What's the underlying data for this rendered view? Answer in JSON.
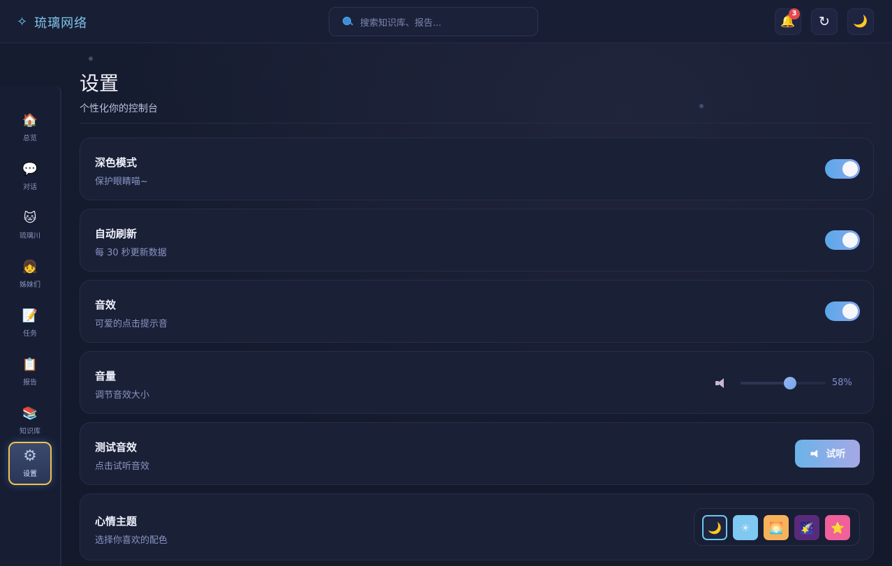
{
  "app": {
    "brand_icon": "sparkle-icon",
    "brand_name": "琉璃网络"
  },
  "search": {
    "placeholder": "搜索知识库、报告..."
  },
  "topbar": {
    "notification_count": "3",
    "bell_icon": "🔔",
    "refresh_icon": "↻",
    "theme_toggle_icon": "🌙"
  },
  "sidebar": {
    "items": [
      {
        "icon": "🏠",
        "label": "总览"
      },
      {
        "icon": "💬",
        "label": "对话"
      },
      {
        "icon": "🐱",
        "label": "琉璃川"
      },
      {
        "icon": "👧",
        "label": "姊妹们"
      },
      {
        "icon": "📝",
        "label": "任务"
      },
      {
        "icon": "📋",
        "label": "报告"
      },
      {
        "icon": "📚",
        "label": "知识库"
      },
      {
        "icon": "⚙",
        "label": "设置"
      }
    ],
    "active_index": 7
  },
  "page": {
    "title": "设置",
    "subtitle": "个性化你的控制台"
  },
  "settings": {
    "dark_mode": {
      "title": "深色模式",
      "desc": "保护眼睛喵~",
      "enabled": true
    },
    "auto_refresh": {
      "title": "自动刷新",
      "desc": "每 30 秒更新数据",
      "enabled": true
    },
    "sound": {
      "title": "音效",
      "desc": "可爱的点击提示音",
      "enabled": true
    },
    "volume": {
      "title": "音量",
      "desc": "调节音效大小",
      "value": 58,
      "value_label": "58%"
    },
    "test_sound": {
      "title": "测试音效",
      "desc": "点击试听音效",
      "button_label": "试听"
    },
    "mood_theme": {
      "title": "心情主题",
      "desc": "选择你喜欢的配色",
      "options": [
        {
          "icon": "🌙",
          "bg": "#1d2540"
        },
        {
          "icon": "☀",
          "bg": "#7ec8f2"
        },
        {
          "icon": "🌅",
          "bg": "#f6b25a"
        },
        {
          "icon": "🌠",
          "bg": "#5a2a7a"
        },
        {
          "icon": "⭐",
          "bg": "#f0609a"
        }
      ],
      "selected_index": 0
    }
  },
  "colors": {
    "accent": "#6cc6f0",
    "toggle_on": "#5aa8ea",
    "active_border": "#f2c14e",
    "badge": "#e5484d"
  }
}
